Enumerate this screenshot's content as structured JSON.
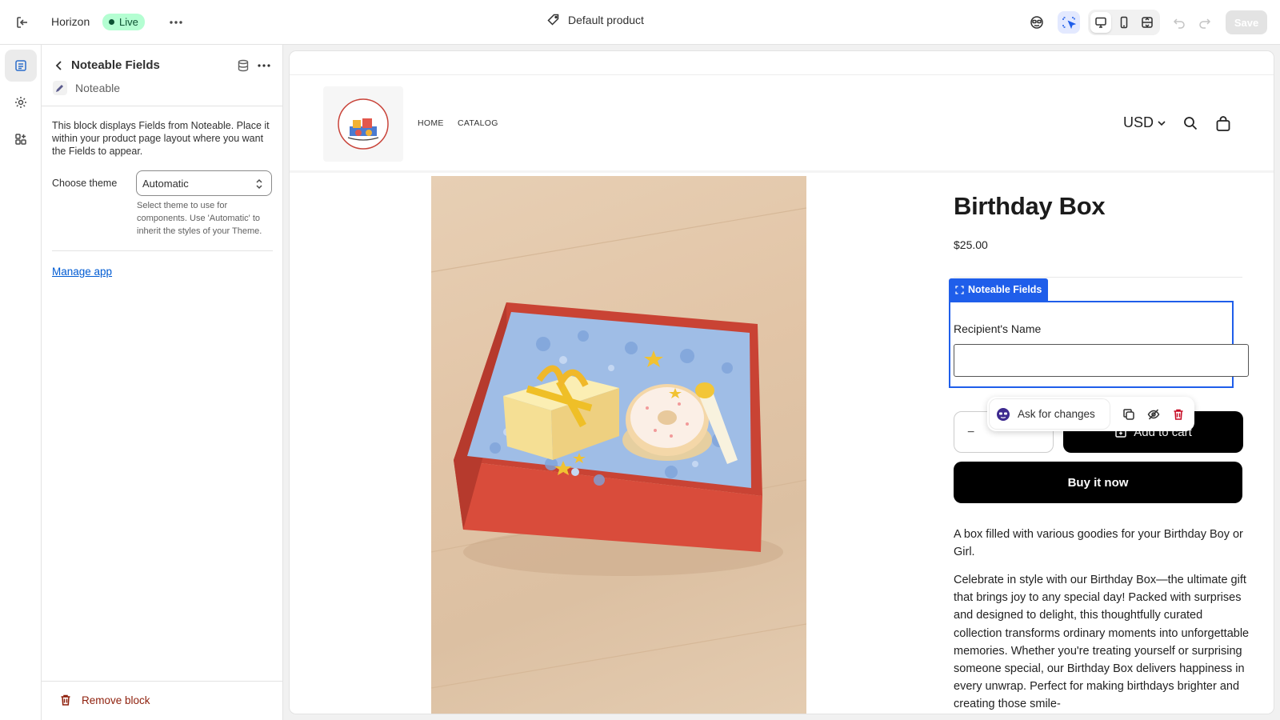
{
  "topbar": {
    "store_name": "Horizon",
    "status_badge": "Live",
    "template_name": "Default product",
    "save_label": "Save"
  },
  "panel": {
    "title": "Noteable Fields",
    "app_name": "Noteable",
    "description": "This block displays Fields from Noteable. Place it within your product page layout where you want the Fields to appear.",
    "theme_label": "Choose theme",
    "theme_value": "Automatic",
    "theme_help": "Select theme to use for components. Use 'Automatic' to inherit the styles of your Theme.",
    "manage_link": "Manage app",
    "remove_label": "Remove block"
  },
  "store": {
    "nav": [
      "HOME",
      "CATALOG"
    ],
    "currency": "USD"
  },
  "product": {
    "title": "Birthday Box",
    "price": "$25.00",
    "block_tag": "Noteable Fields",
    "field_label": "Recipient's Name",
    "field_value": "",
    "qty_minus": "−",
    "add_to_cart": "Add to cart",
    "buy_now": "Buy it now",
    "short_desc": "A box filled with various goodies for your Birthday Boy or Girl.",
    "long_desc": "Celebrate in style with our Birthday Box—the ultimate gift that brings joy to any special day! Packed with surprises and designed to delight, this thoughtfully curated collection transforms ordinary moments into unforgettable memories. Whether you're treating yourself or surprising someone special, our Birthday Box delivers happiness in every unwrap. Perfect for making birthdays brighter and creating those smile-"
  },
  "popover": {
    "ask_label": "Ask for changes"
  },
  "colors": {
    "accent_blue": "#1f5eea",
    "live_bg": "#b4fed2",
    "live_text": "#0c5132",
    "remove_red": "#8e1f0b",
    "link_blue": "#005bd3"
  }
}
